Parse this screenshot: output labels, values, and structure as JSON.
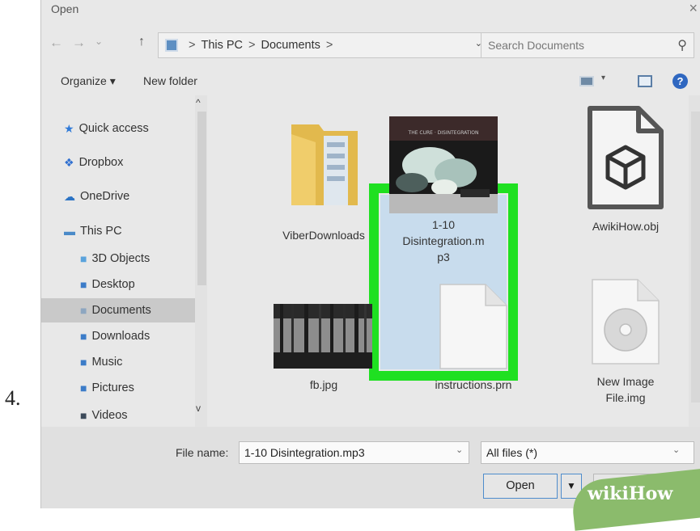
{
  "step": {
    "number": "4."
  },
  "window": {
    "title": "Open",
    "close": "×"
  },
  "nav": {
    "back": "←",
    "forward": "→",
    "history": "⌄",
    "up": "↑"
  },
  "address": {
    "crumbs": [
      "This PC",
      "Documents"
    ],
    "separator": ">",
    "dropdown": "⌄",
    "refresh": "↻"
  },
  "search": {
    "placeholder": "Search Documents",
    "icon": "⚲"
  },
  "toolbar": {
    "organize": "Organize ▾",
    "new_folder": "New folder",
    "view_caret": "▾",
    "help": "?"
  },
  "sidebar": {
    "items": [
      {
        "label": "Quick access",
        "icon": "★",
        "color": "#2f7ad8"
      },
      {
        "label": "Dropbox",
        "icon": "❖",
        "color": "#2f6fd0"
      },
      {
        "label": "OneDrive",
        "icon": "☁",
        "color": "#2b73c4"
      },
      {
        "label": "This PC",
        "icon": "▬",
        "color": "#4a8ac8"
      },
      {
        "label": "3D Objects",
        "icon": "■",
        "color": "#5aa3dc"
      },
      {
        "label": "Desktop",
        "icon": "■",
        "color": "#3c7cc8"
      },
      {
        "label": "Documents",
        "icon": "■",
        "color": "#8da6c0"
      },
      {
        "label": "Downloads",
        "icon": "■",
        "color": "#3c7cc8"
      },
      {
        "label": "Music",
        "icon": "■",
        "color": "#3c7cc8"
      },
      {
        "label": "Pictures",
        "icon": "■",
        "color": "#3c7cc8"
      },
      {
        "label": "Videos",
        "icon": "■",
        "color": "#3c4a5a"
      }
    ],
    "scroll_up": "^",
    "scroll_down": "v"
  },
  "files": [
    {
      "name": "ViberDownloads",
      "type": "folder"
    },
    {
      "name": "1-10 Disintegration.mp3",
      "lines": [
        "1-10",
        "Disintegration.m",
        "p3"
      ],
      "type": "audio",
      "selected": true
    },
    {
      "name": "AwikiHow.obj",
      "type": "obj"
    },
    {
      "name": "fb.jpg",
      "type": "image"
    },
    {
      "name": "instructions.prn",
      "type": "document"
    },
    {
      "name": "New Image File.img",
      "lines": [
        "New Image",
        "File.img"
      ],
      "type": "disc-image"
    }
  ],
  "highlight_color": "#1fe021",
  "footer": {
    "file_name_label": "File name:",
    "file_name_value": "1-10 Disintegration.mp3",
    "file_type": "All files (*)",
    "dropdown": "⌄",
    "open": "Open",
    "open_arrow": "▼",
    "cancel": "Cancel"
  },
  "watermark": {
    "text": "wikiHow"
  }
}
